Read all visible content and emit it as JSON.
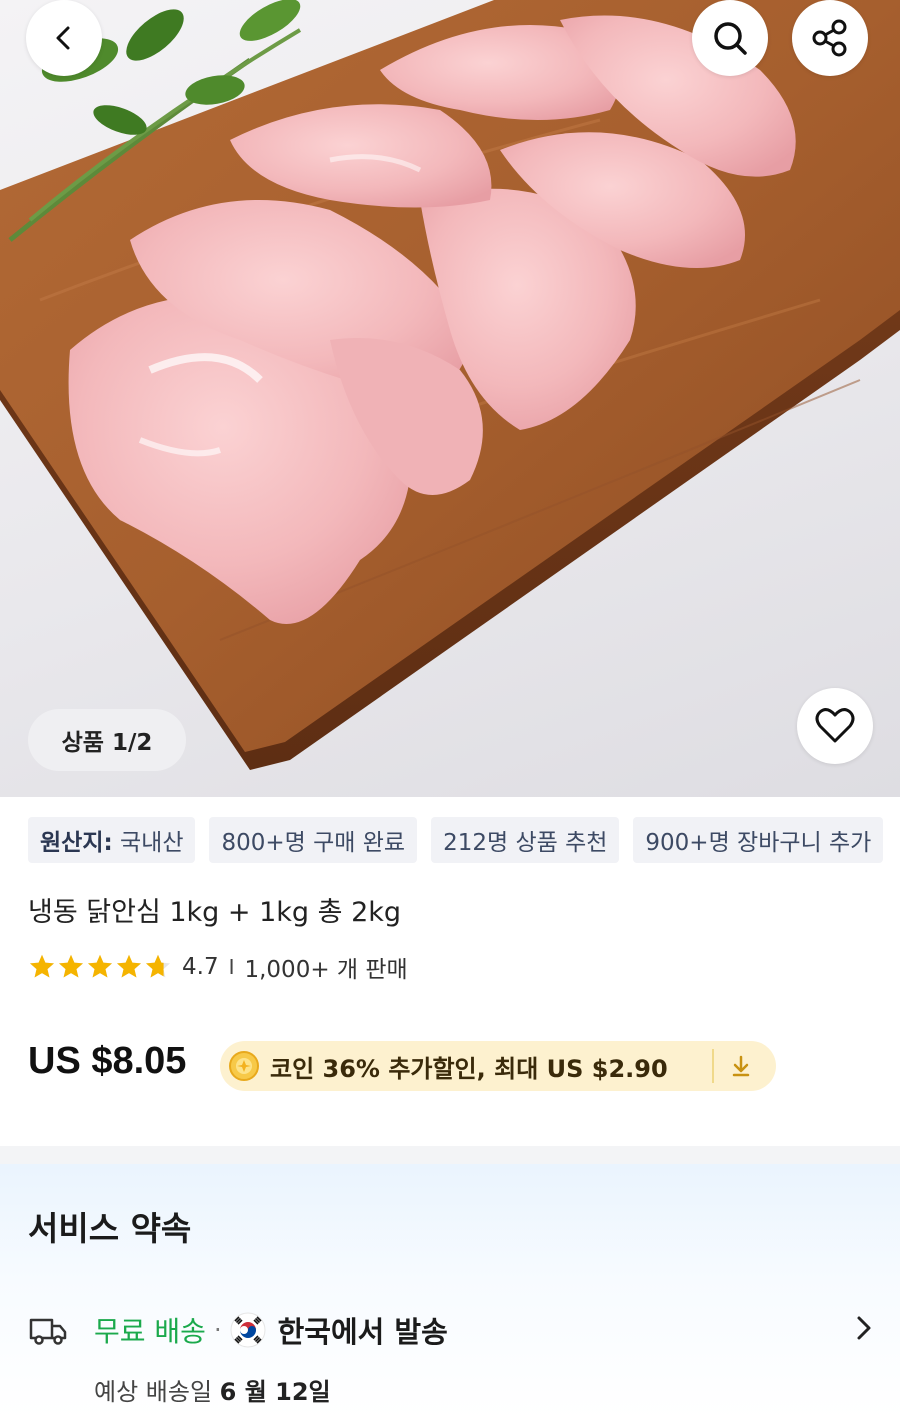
{
  "header": {
    "back_icon": "chevron-left-icon",
    "search_icon": "search-icon",
    "share_icon": "share-icon"
  },
  "gallery": {
    "counter": "상품 1/2",
    "wishlist_icon": "heart-icon"
  },
  "tags": {
    "origin_label": "원산지:",
    "origin_value": "국내산",
    "purchased": "800+명 구매 완료",
    "recommended": "212명 상품 추천",
    "cart": "900+명 장바구니 추가"
  },
  "product": {
    "title": "냉동 닭안심 1kg + 1kg 총 2kg",
    "rating": "4.7",
    "rating_stars": 4.7,
    "separator": "I",
    "sold": "1,000+ 개 판매"
  },
  "price": {
    "amount": "US $8.05",
    "coin_text": "코인 36% 추가할인, 최대 US $2.90",
    "coin_icon": "coin-icon",
    "download_icon": "download-icon"
  },
  "service": {
    "title": "서비스 약속",
    "free_shipping": "무료 배송",
    "dot": "·",
    "ship_from": "한국에서 발송",
    "eta_label": "예상 배송일",
    "eta_date": "6 월 12일"
  },
  "colors": {
    "accent_green": "#1ba94c",
    "star": "#f5b400",
    "coin_bg": "#fdf1cf"
  }
}
